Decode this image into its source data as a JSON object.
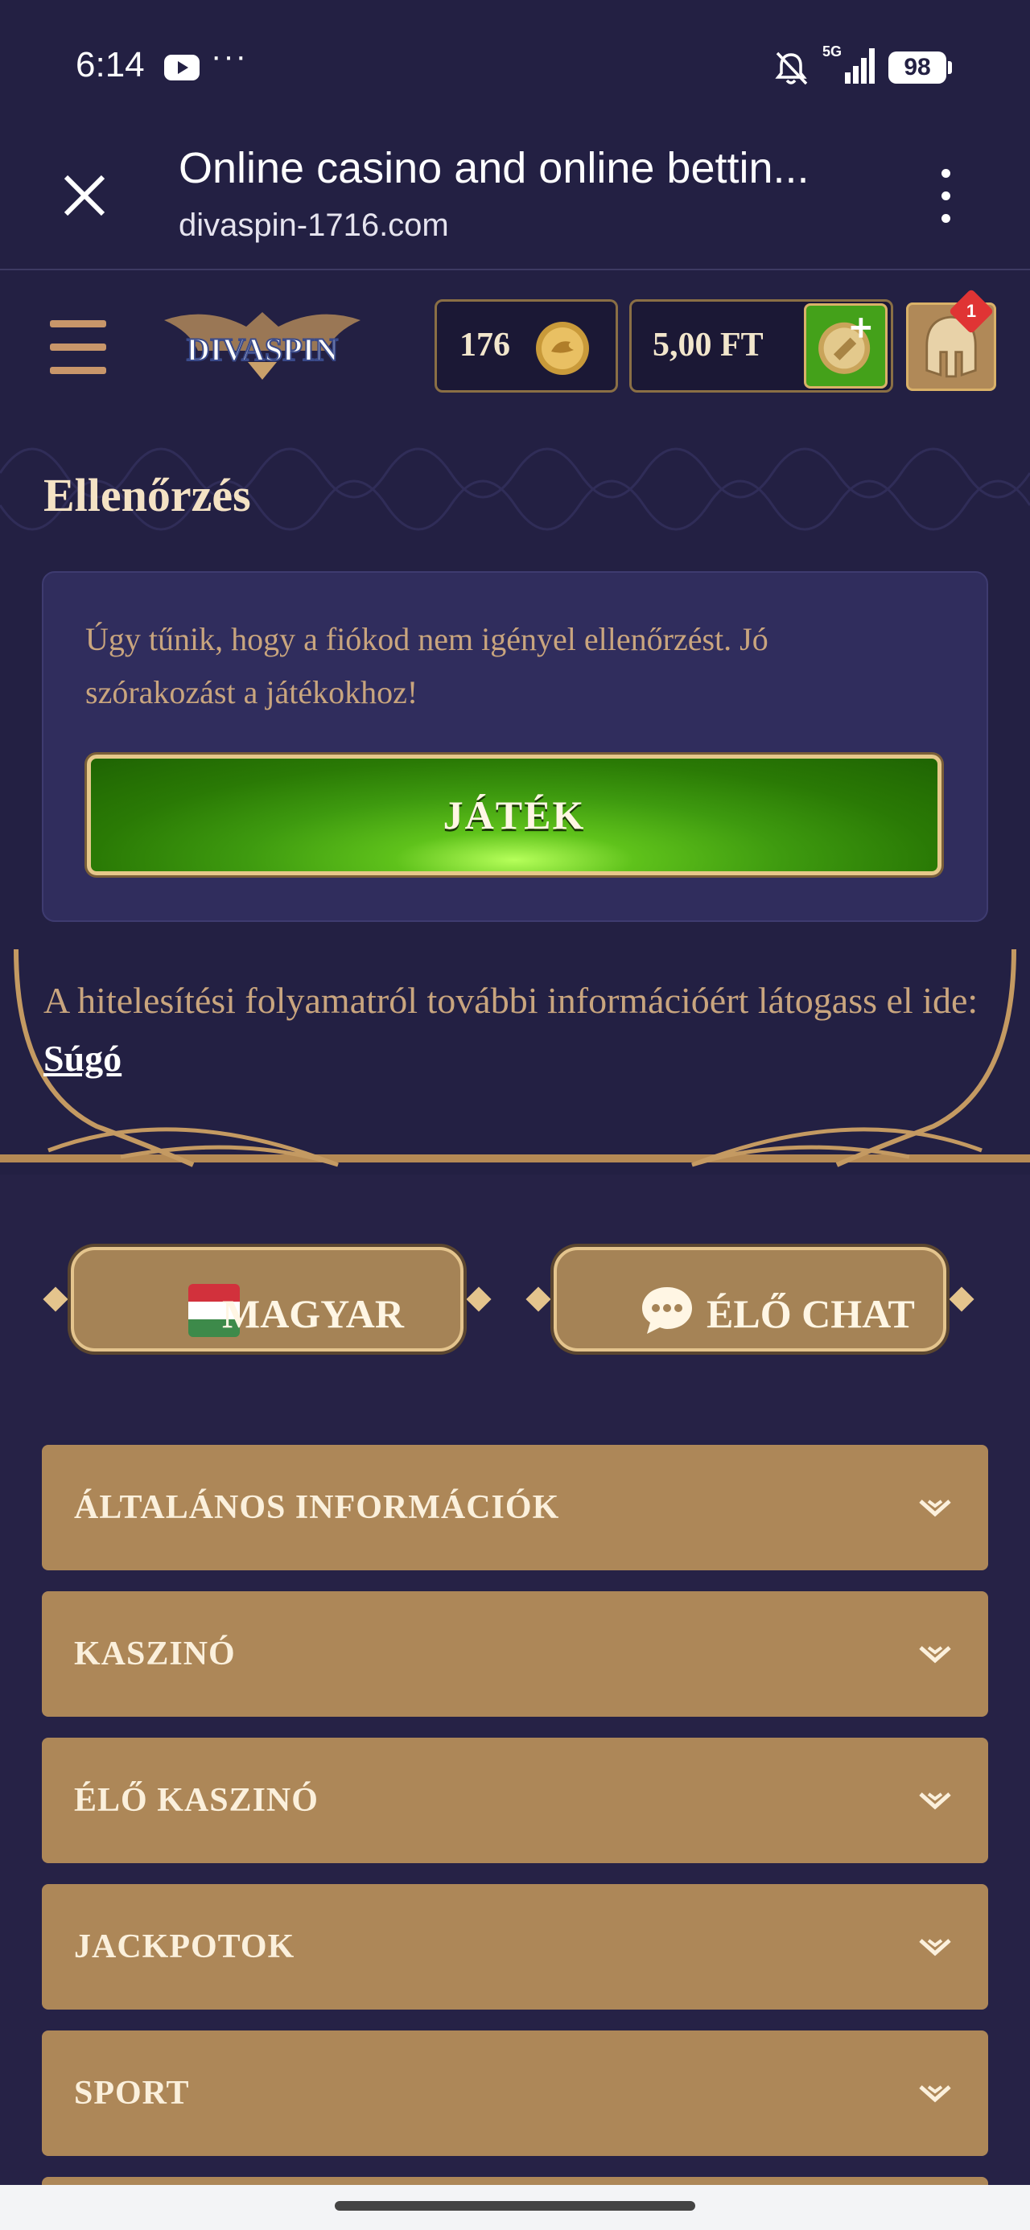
{
  "status_bar": {
    "time": "6:14",
    "dots": "···",
    "battery": "98"
  },
  "browser": {
    "title": "Online casino and online bettin...",
    "url": "divaspin-1716.com"
  },
  "header": {
    "logo_text": "DIVASPIN",
    "coins": "176",
    "balance": "5,00 FT",
    "notification_count": "1"
  },
  "main": {
    "title": "Ellenőrzés",
    "notice": "Úgy tűnik, hogy a fiókod nem igényel ellenőrzést. Jó szórakozást a játékokhoz!",
    "play_button": "JÁTÉK",
    "info_text": "A hitelesítési folyamatról további információért látogass el ide: ",
    "info_link": "Súgó"
  },
  "footer": {
    "language_button": "MAGYAR",
    "chat_button": "ÉLŐ CHAT",
    "accordion": [
      {
        "label": "ÁLTALÁNOS INFORMÁCIÓK"
      },
      {
        "label": "KASZINÓ"
      },
      {
        "label": "ÉLŐ KASZINÓ"
      },
      {
        "label": "JACKPOTOK"
      },
      {
        "label": "SPORT"
      }
    ]
  },
  "colors": {
    "background": "#232043",
    "gold": "#ad8758",
    "play_green": "#44a11a",
    "text_tan": "#c9a57e"
  }
}
